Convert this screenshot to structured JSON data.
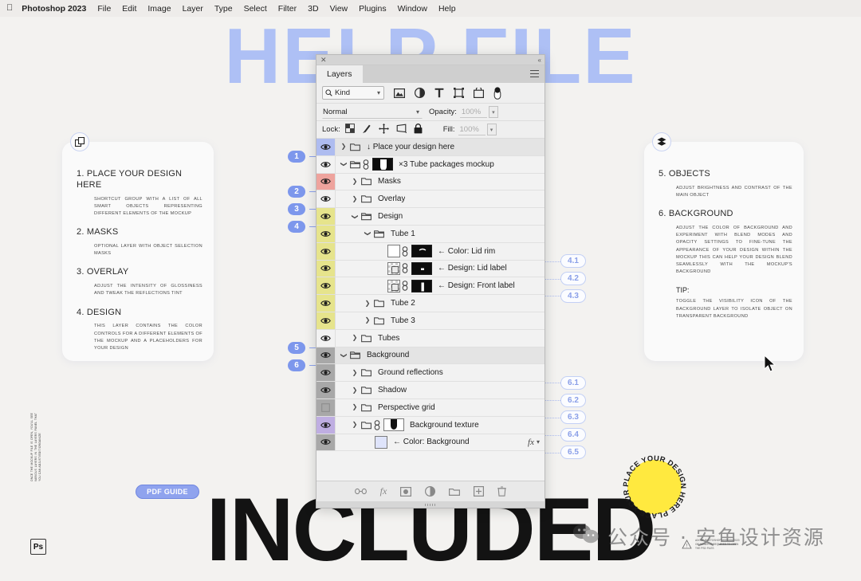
{
  "menubar": {
    "apple_icon": "apple-logo-icon",
    "appname": "Photoshop 2023",
    "items": [
      "File",
      "Edit",
      "Image",
      "Layer",
      "Type",
      "Select",
      "Filter",
      "3D",
      "View",
      "Plugins",
      "Window",
      "Help"
    ]
  },
  "background_text": {
    "top": "HELP FILE",
    "bottom": "INCLUDED"
  },
  "cards": {
    "left": {
      "badge_icon": "smart-object-icon",
      "sections": [
        {
          "num": "1.",
          "title": "PLACE YOUR DESIGN HERE",
          "body": "SHORTCUT GROUP WITH A LIST OF ALL SMART OBJECTS REPRESENTING DIFFERENT ELEMENTS OF THE MOCKUP"
        },
        {
          "num": "2.",
          "title": "MASKS",
          "body": "OPTIONAL LAYER WITH OBJECT SELECTION MASKS"
        },
        {
          "num": "3.",
          "title": "OVERLAY",
          "body": "ADJUST THE INTENSITY OF GLOSSINESS AND TWEAK THE REFLECTIONS TINT"
        },
        {
          "num": "4.",
          "title": "DESIGN",
          "body": "THIS LAYER CONTAINS THE COLOR CONTROLS FOR A DIFFERENT ELEMENTS OF THE MOCKUP AND A PLACEHOLDERS FOR YOUR DESIGN"
        }
      ]
    },
    "right": {
      "badge_icon": "layers-stack-icon",
      "sections": [
        {
          "num": "5.",
          "title": "OBJECTS",
          "body": "ADJUST BRIGHTNESS AND CONTRAST OF THE MAIN OBJECT"
        },
        {
          "num": "6.",
          "title": "BACKGROUND",
          "body": "ADJUST THE COLOR OF BACKGROUND AND EXPERIMENT WITH BLEND MODES AND OPACITY SETTINGS TO FINE-TUNE THE APPEARANCE OF YOUR DESIGN WITHIN THE MOCKUP THIS CAN HELP YOUR DESIGN BLEND SEAMLESSLY WITH THE MOCKUP'S BACKGROUND"
        }
      ],
      "tip_title": "TIP:",
      "tip_body": "TOGGLE THE VISIBILITY ICON OF THE BACKGROUND LAYER TO ISOLATE OBJECT ON TRANSPARENT BACKGROUND"
    }
  },
  "sidenote": "ONCE THE MOCKUP FILE IS OPEN, YOU'LL SEE VARIOUS LAYERS IN THE LAYERS PANEL THAT YOU CAN ADJUST/EDIT/ORGANIZE",
  "ps_badge": "Ps",
  "pdf_guide_label": "PDF GUIDE",
  "sticker_text": "PLACE YOUR DESIGN HERE PLACE YOUR DESIGN HERE ",
  "watermark": {
    "icon": "wechat-icon",
    "text": "公众号 · 安鱼设计资源"
  },
  "warn_note": {
    "icon": "warning-triangle-icon",
    "text": "ADOBE PHOTOSHOP VERSION 2020 OR NEWER IS REQUIRED TO OPEN THE PSD FILES"
  },
  "colors": {
    "accent": "#7d97ec",
    "accent_soft": "#aec0f5",
    "sticker": "#ffe93f",
    "panel_bg": "#d6d6d6",
    "row_bg": "#f2f2f2",
    "vis_blue": "#aebcf0",
    "vis_red": "#eea39d",
    "vis_yellow": "#e6e48c",
    "vis_gray": "#a8a8a8",
    "vis_purple": "#bfaee2"
  },
  "panel": {
    "titlebar": {
      "close_icon": "close-icon",
      "collapse_icon": "collapse-double-chevron-icon"
    },
    "tab_label": "Layers",
    "menu_icon": "panel-menu-icon",
    "filter": {
      "search_icon": "search-icon",
      "kind_value": "Kind",
      "chevron_icon": "chevron-down-icon",
      "filter_icons": [
        "image-filter-icon",
        "adjustment-filter-icon",
        "type-filter-icon",
        "shape-filter-icon",
        "smart-object-filter-icon",
        "toggle-filter-icon"
      ]
    },
    "blend": {
      "mode_value": "Normal",
      "opacity_label": "Opacity:",
      "opacity_value": "100%"
    },
    "lock": {
      "label": "Lock:",
      "icons": [
        "lock-transparency-icon",
        "lock-image-icon",
        "lock-position-icon",
        "lock-artboard-icon",
        "lock-all-icon"
      ],
      "fill_label": "Fill:",
      "fill_value": "100%"
    },
    "footer_icons": [
      "link-layers-icon",
      "add-fx-icon",
      "add-mask-icon",
      "new-adjustment-icon",
      "new-group-icon",
      "new-layer-icon",
      "delete-layer-icon"
    ],
    "resize_icon": "resize-grip-icon"
  },
  "layers": [
    {
      "name": "↓ Place your design here",
      "indent": 1,
      "vis": true,
      "vis_bg": "#aebcf0",
      "twisty": "collapsed",
      "folder": true,
      "link": false,
      "thumb": null,
      "selected": true,
      "fx": false
    },
    {
      "name": "×3 Tube packages mockup",
      "indent": 1,
      "vis": true,
      "vis_bg": "",
      "twisty": "expanded",
      "folder": true,
      "link": true,
      "thumb": "dark-mask",
      "selected": false,
      "fx": false
    },
    {
      "name": "Masks",
      "indent": 2,
      "vis": true,
      "vis_bg": "#eea39d",
      "twisty": "collapsed",
      "folder": true,
      "link": false,
      "thumb": null,
      "selected": false,
      "fx": false
    },
    {
      "name": "Overlay",
      "indent": 2,
      "vis": true,
      "vis_bg": "",
      "twisty": "collapsed",
      "folder": true,
      "link": false,
      "thumb": null,
      "selected": false,
      "fx": false
    },
    {
      "name": "Design",
      "indent": 2,
      "vis": true,
      "vis_bg": "#e6e48c",
      "twisty": "expanded",
      "folder": true,
      "link": false,
      "thumb": null,
      "selected": false,
      "fx": false
    },
    {
      "name": "Tube 1",
      "indent": 3,
      "vis": true,
      "vis_bg": "#e6e48c",
      "twisty": "expanded",
      "folder": true,
      "link": false,
      "thumb": null,
      "selected": false,
      "fx": false
    },
    {
      "name": "← Color: Lid rim",
      "indent": 4,
      "vis": true,
      "vis_bg": "#e6e48c",
      "twisty": "none",
      "folder": false,
      "link": true,
      "thumb": "white+dark",
      "selected": false,
      "fx": false
    },
    {
      "name": "← Design: Lid label",
      "indent": 4,
      "vis": true,
      "vis_bg": "#e6e48c",
      "twisty": "none",
      "folder": false,
      "link": true,
      "thumb": "smart+dark",
      "selected": false,
      "fx": false
    },
    {
      "name": "← Design: Front label",
      "indent": 4,
      "vis": true,
      "vis_bg": "#e6e48c",
      "twisty": "none",
      "folder": false,
      "link": true,
      "thumb": "smart+dark2",
      "selected": false,
      "fx": false
    },
    {
      "name": "Tube 2",
      "indent": 3,
      "vis": true,
      "vis_bg": "#e6e48c",
      "twisty": "collapsed",
      "folder": true,
      "link": false,
      "thumb": null,
      "selected": false,
      "fx": false
    },
    {
      "name": "Tube 3",
      "indent": 3,
      "vis": true,
      "vis_bg": "#e6e48c",
      "twisty": "collapsed",
      "folder": true,
      "link": false,
      "thumb": null,
      "selected": false,
      "fx": false
    },
    {
      "name": "Tubes",
      "indent": 2,
      "vis": true,
      "vis_bg": "",
      "twisty": "collapsed",
      "folder": true,
      "link": false,
      "thumb": null,
      "selected": false,
      "fx": false
    },
    {
      "name": "Background",
      "indent": 1,
      "vis": true,
      "vis_bg": "#a8a8a8",
      "twisty": "expanded",
      "folder": true,
      "link": false,
      "thumb": null,
      "selected": true,
      "fx": false
    },
    {
      "name": "Ground reflections",
      "indent": 2,
      "vis": true,
      "vis_bg": "#a8a8a8",
      "twisty": "collapsed",
      "folder": true,
      "link": false,
      "thumb": null,
      "selected": false,
      "fx": false
    },
    {
      "name": "Shadow",
      "indent": 2,
      "vis": true,
      "vis_bg": "#a8a8a8",
      "twisty": "collapsed",
      "folder": true,
      "link": false,
      "thumb": null,
      "selected": false,
      "fx": false
    },
    {
      "name": "Perspective grid",
      "indent": 2,
      "vis": false,
      "vis_bg": "#a8a8a8",
      "twisty": "collapsed",
      "folder": true,
      "link": false,
      "thumb": null,
      "selected": false,
      "fx": false
    },
    {
      "name": "Background texture",
      "indent": 2,
      "vis": true,
      "vis_bg": "#bfaee2",
      "twisty": "collapsed",
      "folder": true,
      "link": true,
      "thumb": "white-mask",
      "selected": false,
      "fx": false
    },
    {
      "name": "← Color: Background",
      "indent": 3,
      "vis": true,
      "vis_bg": "#a8a8a8",
      "twisty": "none",
      "folder": false,
      "link": false,
      "thumb": "lilac",
      "selected": false,
      "fx": true
    }
  ],
  "callouts": [
    {
      "label": "1",
      "row": 0
    },
    {
      "label": "2",
      "row": 2
    },
    {
      "label": "3",
      "row": 3
    },
    {
      "label": "4",
      "row": 4
    },
    {
      "label": "5",
      "row": 11
    },
    {
      "label": "6",
      "row": 12
    }
  ],
  "sub_callouts": [
    {
      "label": "4.1",
      "row": 6
    },
    {
      "label": "4.2",
      "row": 7
    },
    {
      "label": "4.3",
      "row": 8
    },
    {
      "label": "6.1",
      "row": 13
    },
    {
      "label": "6.2",
      "row": 14
    },
    {
      "label": "6.3",
      "row": 15
    },
    {
      "label": "6.4",
      "row": 16
    },
    {
      "label": "6.5",
      "row": 17
    }
  ]
}
